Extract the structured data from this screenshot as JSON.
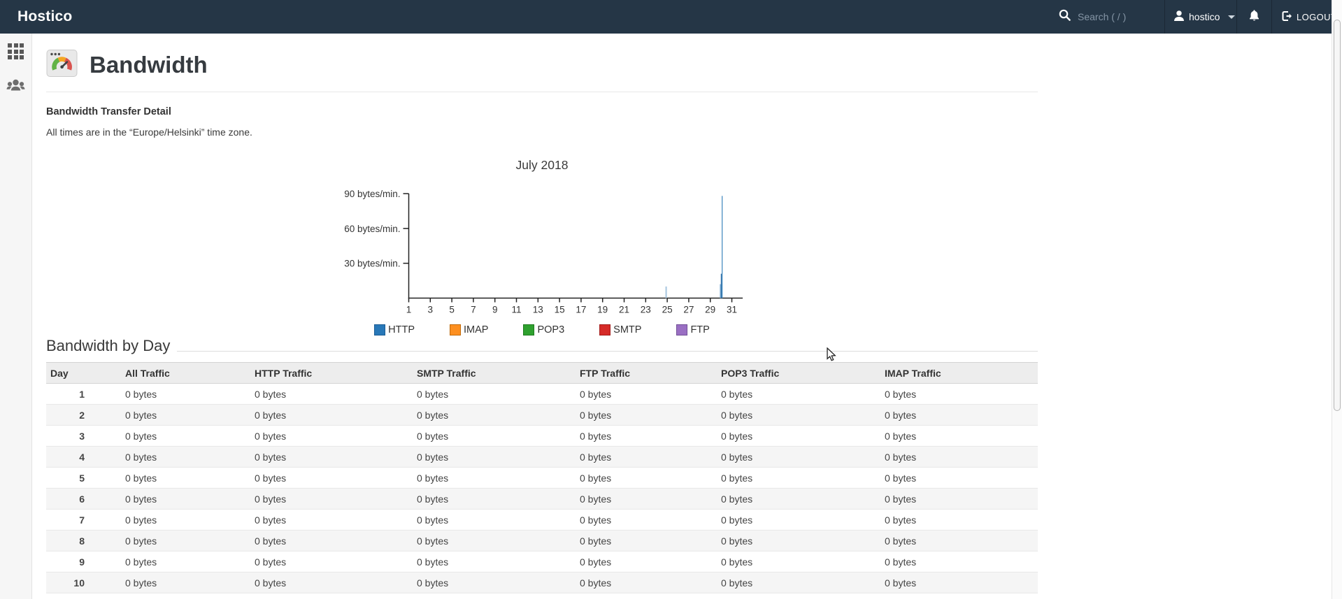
{
  "navbar": {
    "brand": "Hostico",
    "search": {
      "placeholder": "Search ( / )",
      "icon": "search-icon"
    },
    "user": {
      "name": "hostico",
      "icon": "user-icon",
      "caret_icon": "caret-down-icon"
    },
    "notifications": {
      "icon": "bell-icon"
    },
    "logout": {
      "label": "LOGOUT",
      "icon": "logout-icon"
    }
  },
  "sidebar": {
    "items": [
      {
        "id": "applications",
        "icon": "grid-icon"
      },
      {
        "id": "accounts",
        "icon": "users-icon"
      }
    ]
  },
  "page": {
    "icon": "bandwidth-gauge-icon",
    "title": "Bandwidth",
    "detail_heading": "Bandwidth Transfer Detail",
    "timezone_note": "All times are in the “Europe/Helsinki” time zone.",
    "byday_heading": "Bandwidth by Day"
  },
  "chart_data": {
    "type": "bar",
    "title": "July 2018",
    "xlabel": "",
    "ylabel": "",
    "x_range": [
      1,
      31
    ],
    "x_tick_labels": [
      1,
      3,
      5,
      7,
      9,
      11,
      13,
      15,
      17,
      19,
      21,
      23,
      25,
      27,
      29,
      31
    ],
    "ylim": [
      0,
      90
    ],
    "y_ticks": [
      {
        "value": 30,
        "label": "30 bytes/min."
      },
      {
        "value": 60,
        "label": "60 bytes/min."
      },
      {
        "value": 90,
        "label": "90 bytes/min."
      }
    ],
    "grid": false,
    "legend_position": "bottom",
    "legend": [
      {
        "label": "HTTP",
        "color": "#2878b8",
        "border": "#1a5c94"
      },
      {
        "label": "IMAP",
        "color": "#fd8f20",
        "border": "#c06a0a"
      },
      {
        "label": "POP3",
        "color": "#2fa12f",
        "border": "#1e7a1e"
      },
      {
        "label": "SMTP",
        "color": "#d62b28",
        "border": "#a31b19"
      },
      {
        "label": "FTP",
        "color": "#9a6fc3",
        "border": "#714f96"
      }
    ],
    "series": [
      {
        "name": "HTTP",
        "bars": [
          {
            "day": 24.9,
            "value": 10,
            "width": 2,
            "color": "#a6c6e0"
          },
          {
            "day": 30.0,
            "value": 12,
            "width": 3.6,
            "color": "#86b4d8"
          },
          {
            "day": 30.05,
            "value": 21,
            "width": 2.2,
            "color": "#2e6da4"
          },
          {
            "day": 30.1,
            "value": 88,
            "width": 1.3,
            "color": "#4a8ec2"
          }
        ]
      },
      {
        "name": "IMAP",
        "bars": []
      },
      {
        "name": "POP3",
        "bars": []
      },
      {
        "name": "SMTP",
        "bars": []
      },
      {
        "name": "FTP",
        "bars": []
      }
    ]
  },
  "table": {
    "columns": [
      "Day",
      "All Traffic",
      "HTTP Traffic",
      "SMTP Traffic",
      "FTP Traffic",
      "POP3 Traffic",
      "IMAP Traffic"
    ],
    "rows": [
      {
        "day": "1",
        "values": [
          "0 bytes",
          "0 bytes",
          "0 bytes",
          "0 bytes",
          "0 bytes",
          "0 bytes"
        ]
      },
      {
        "day": "2",
        "values": [
          "0 bytes",
          "0 bytes",
          "0 bytes",
          "0 bytes",
          "0 bytes",
          "0 bytes"
        ]
      },
      {
        "day": "3",
        "values": [
          "0 bytes",
          "0 bytes",
          "0 bytes",
          "0 bytes",
          "0 bytes",
          "0 bytes"
        ]
      },
      {
        "day": "4",
        "values": [
          "0 bytes",
          "0 bytes",
          "0 bytes",
          "0 bytes",
          "0 bytes",
          "0 bytes"
        ]
      },
      {
        "day": "5",
        "values": [
          "0 bytes",
          "0 bytes",
          "0 bytes",
          "0 bytes",
          "0 bytes",
          "0 bytes"
        ]
      },
      {
        "day": "6",
        "values": [
          "0 bytes",
          "0 bytes",
          "0 bytes",
          "0 bytes",
          "0 bytes",
          "0 bytes"
        ]
      },
      {
        "day": "7",
        "values": [
          "0 bytes",
          "0 bytes",
          "0 bytes",
          "0 bytes",
          "0 bytes",
          "0 bytes"
        ]
      },
      {
        "day": "8",
        "values": [
          "0 bytes",
          "0 bytes",
          "0 bytes",
          "0 bytes",
          "0 bytes",
          "0 bytes"
        ]
      },
      {
        "day": "9",
        "values": [
          "0 bytes",
          "0 bytes",
          "0 bytes",
          "0 bytes",
          "0 bytes",
          "0 bytes"
        ]
      },
      {
        "day": "10",
        "values": [
          "0 bytes",
          "0 bytes",
          "0 bytes",
          "0 bytes",
          "0 bytes",
          "0 bytes"
        ]
      }
    ]
  },
  "colors": {
    "navbar_bg": "#253646",
    "sidebar_bg": "#f6f6f6",
    "table_header_bg": "#ededed",
    "row_stripe": "#f5f5f5",
    "axis": "#222222"
  }
}
